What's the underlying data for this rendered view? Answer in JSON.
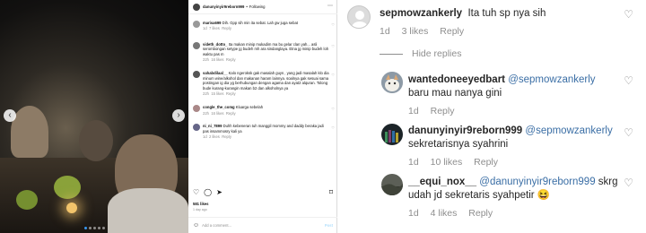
{
  "post": {
    "header": {
      "username": "danunyinyir9reborn999",
      "separator": "•",
      "follow_label": "Following",
      "more_icon": "ellipsis-icon"
    },
    "comments": [
      {
        "user": "marisa699",
        "text": "Dih. Gpp sih min ita sebat. Lah gw juga sebat",
        "time": "1d",
        "likes": "7 likes",
        "reply": "Reply"
      },
      {
        "user": "videth_dotto_",
        "text": "Ita makan minip mukadim ma bu gelar clan yah... asli serombongan setype jg budeh mh ara sindanglaya. Etna jg minip budeh loh waktu pas m",
        "time": "22h",
        "likes": "16 likes",
        "reply": "Reply"
      },
      {
        "user": "sahabdilaal__",
        "text": "Kalo ngeroksk gak masalah guys , yang jadi masalah klo dia minum wine/alkohol dan makanan haram lainnya. soalnya gak sesuai sama postingan ig dia yg berhubungan dengan agama dan ayat2 alquran. Tolong bude kurang-kurangin makan b2 dan alkoholnya ya",
        "time": "22h",
        "likes": "15 likes",
        "reply": "Reply"
      },
      {
        "user": "congle_the_comg",
        "text": "Kluarga sebelah",
        "time": "22h",
        "likes": "16 likes",
        "reply": "Reply"
      },
      {
        "user": "ni_ni_7899",
        "text": "Duhh kebeneran tuh manggil mommy and daddy beraka jadi pas insammosry kali ya",
        "time": "1d",
        "likes": "2 likes",
        "reply": "Reply"
      }
    ],
    "likes": "581 likes",
    "date": "1 day ago",
    "add_comment_placeholder": "Add a comment...",
    "post_label": "Post"
  },
  "thread": {
    "hide_replies": "Hide replies",
    "comments": [
      {
        "user": "sepmowzankerly",
        "text": "Ita tuh sp nya sih",
        "mention": "",
        "time": "1d",
        "likes": "3 likes",
        "reply": "Reply"
      },
      {
        "user": "wantedoneeyedbart",
        "mention": "@sepmowzankerly",
        "text": " baru mau nanya gini",
        "time": "1d",
        "likes": "",
        "reply": "Reply"
      },
      {
        "user": "danunyinyir9reborn999",
        "mention": "@sepmowzankerly",
        "text": "sekretarisnya syahrini",
        "time": "1d",
        "likes": "10 likes",
        "reply": "Reply"
      },
      {
        "user": "__equi_nox__",
        "mention": "@danunyinyir9reborn999",
        "text": " skrg udah jd sekretaris syahpetir 😆",
        "time": "1d",
        "likes": "4 likes",
        "reply": "Reply"
      }
    ]
  },
  "colors": {
    "mention": "#3a6ea5",
    "meta": "#8e8e8e",
    "accent": "#3897f0"
  }
}
